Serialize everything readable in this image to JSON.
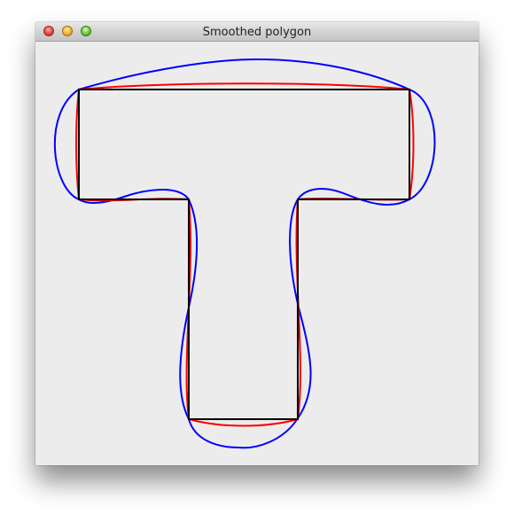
{
  "window": {
    "title": "Smoothed polygon"
  },
  "window_controls": {
    "close_icon": "close-icon",
    "minimize_icon": "minimize-icon",
    "zoom_icon": "zoom-icon"
  },
  "colors": {
    "polygon": "#000000",
    "smoothed_red": "#ff0000",
    "smoothed_blue": "#0000ff",
    "background": "#ececec"
  }
}
